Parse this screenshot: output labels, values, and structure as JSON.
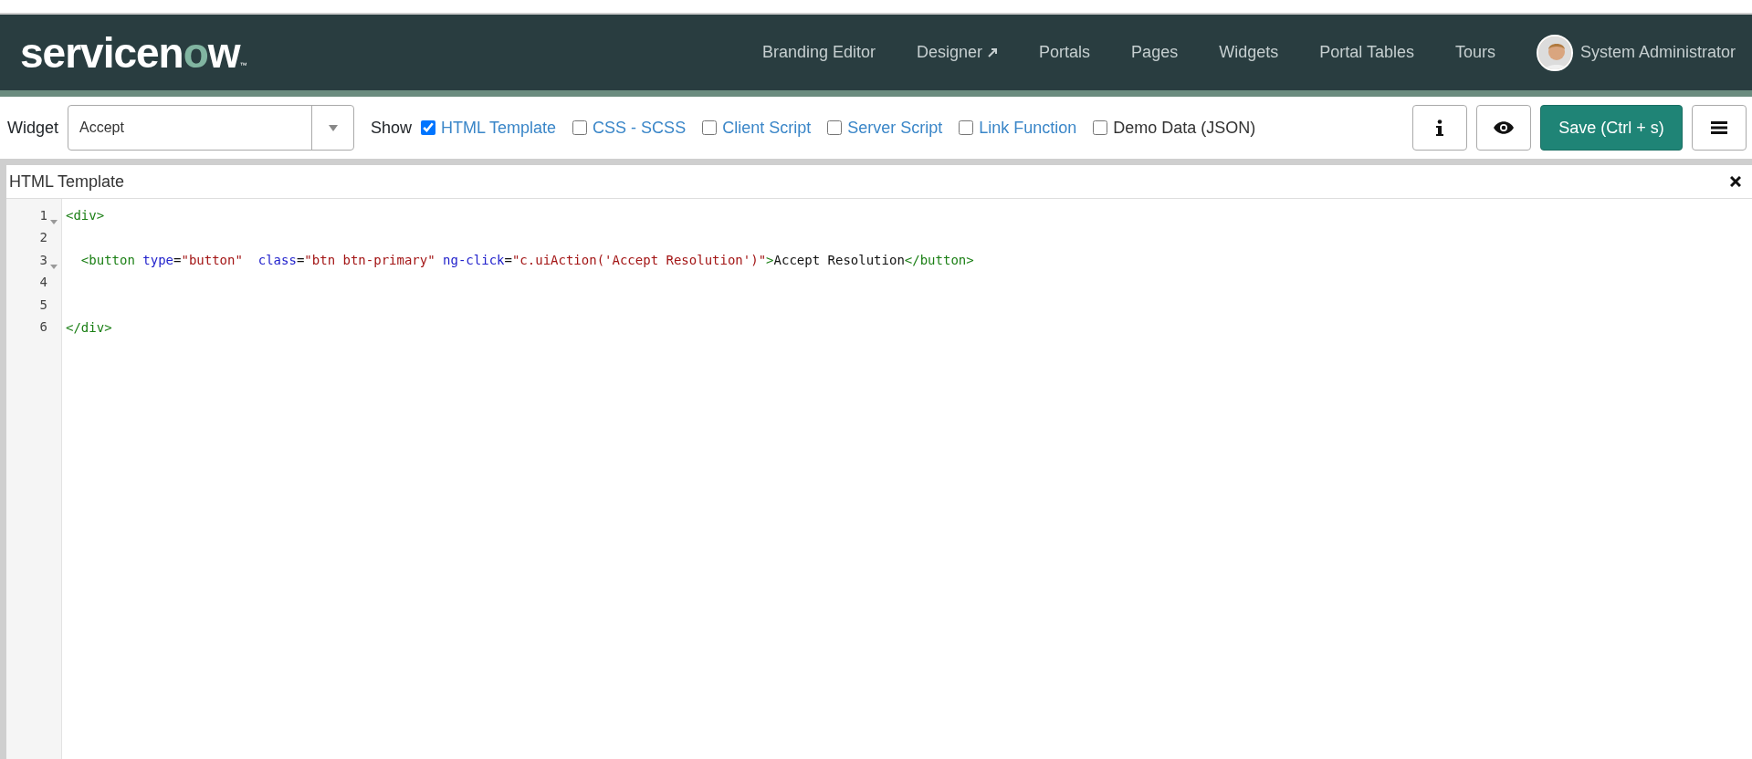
{
  "header": {
    "logo": {
      "parts": [
        {
          "text": "servicen",
          "accent": false
        },
        {
          "text": "o",
          "accent": true
        },
        {
          "text": "w",
          "accent": false
        }
      ],
      "trademark": "™"
    },
    "nav": [
      {
        "label": "Branding Editor",
        "external": false
      },
      {
        "label": "Designer",
        "external": true
      },
      {
        "label": "Portals",
        "external": false
      },
      {
        "label": "Pages",
        "external": false
      },
      {
        "label": "Widgets",
        "external": false
      },
      {
        "label": "Portal Tables",
        "external": false
      },
      {
        "label": "Tours",
        "external": false
      }
    ],
    "user": {
      "name": "System Administrator"
    }
  },
  "toolbar": {
    "widget_label": "Widget",
    "widget_select": {
      "value": "Accept"
    },
    "show_label": "Show",
    "options": [
      {
        "label": "HTML Template",
        "checked": true,
        "kind": "link"
      },
      {
        "label": "CSS - SCSS",
        "checked": false,
        "kind": "link"
      },
      {
        "label": "Client Script",
        "checked": false,
        "kind": "link"
      },
      {
        "label": "Server Script",
        "checked": false,
        "kind": "link"
      },
      {
        "label": "Link Function",
        "checked": false,
        "kind": "link"
      },
      {
        "label": "Demo Data (JSON)",
        "checked": false,
        "kind": "plain"
      }
    ],
    "buttons": [
      {
        "kind": "info"
      },
      {
        "kind": "preview"
      },
      {
        "kind": "save",
        "label": "Save (Ctrl + s)"
      },
      {
        "kind": "menu"
      }
    ]
  },
  "editor": {
    "title": "HTML Template",
    "lines": [
      {
        "number": "1",
        "foldable": true,
        "tokens": [
          {
            "kind": "tag",
            "text": "<div>"
          }
        ]
      },
      {
        "number": "2",
        "foldable": false
      },
      {
        "number": "3",
        "foldable": true,
        "tokens": [
          {
            "kind": "tag",
            "text": "  <button"
          },
          {
            "kind": "attr",
            "text": " type"
          },
          {
            "kind": "text",
            "text": "="
          },
          {
            "kind": "string",
            "text": "\"button\""
          },
          {
            "kind": "attr",
            "text": "  class"
          },
          {
            "kind": "text",
            "text": "="
          },
          {
            "kind": "string",
            "text": "\"btn btn-primary\""
          },
          {
            "kind": "attr",
            "text": " ng-click"
          },
          {
            "kind": "text",
            "text": "="
          },
          {
            "kind": "string",
            "text": "\"c.uiAction('Accept Resolution')\""
          },
          {
            "kind": "tag",
            "text": ">"
          },
          {
            "kind": "text",
            "text": "Accept Resolution"
          },
          {
            "kind": "tag",
            "text": "</button>"
          }
        ]
      },
      {
        "number": "4",
        "foldable": false
      },
      {
        "number": "5",
        "foldable": false
      },
      {
        "number": "6",
        "foldable": false,
        "tokens": [
          {
            "kind": "tag",
            "text": "</div>"
          }
        ]
      }
    ]
  }
}
